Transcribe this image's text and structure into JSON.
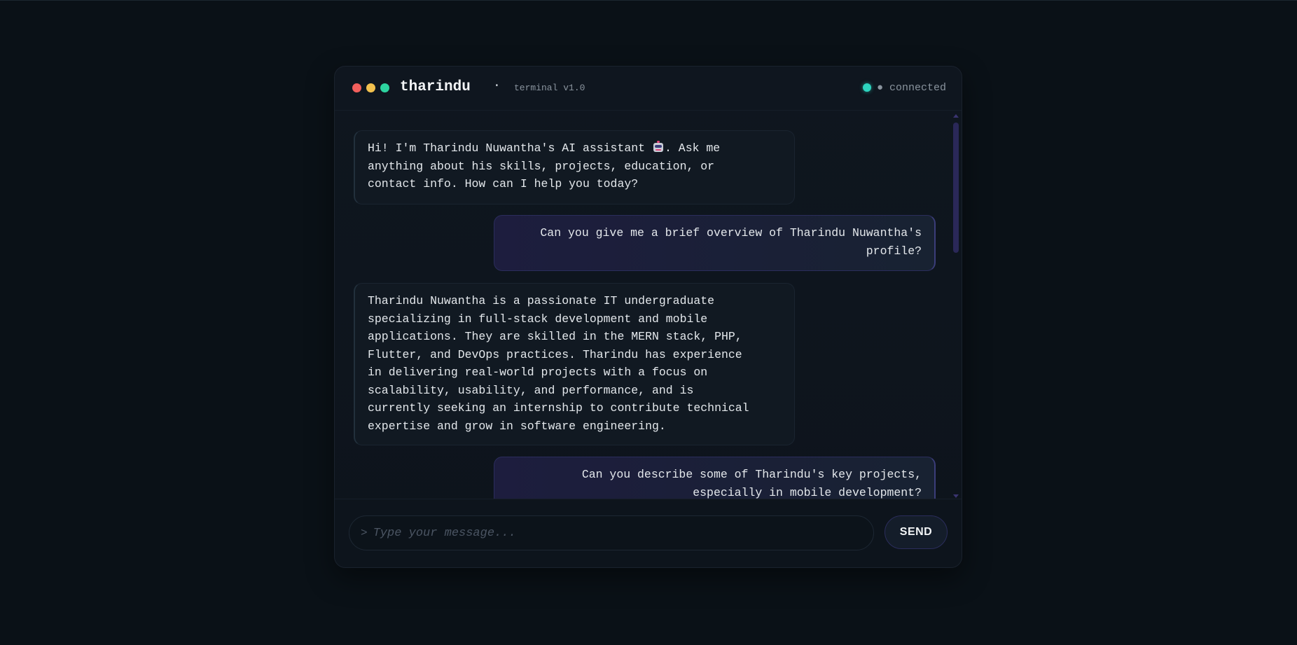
{
  "header": {
    "title": "tharindu",
    "separator": "·",
    "subtitle": "terminal v1.0",
    "status_text": "● connected"
  },
  "messages": [
    {
      "role": "assistant",
      "text_before_icon": "Hi! I'm Tharindu Nuwantha's AI assistant",
      "icon": "robot-icon",
      "text_after_icon": ". Ask me\nanything about his skills, projects, education, or\ncontact info. How can I help you today?"
    },
    {
      "role": "user",
      "text": "Can you give me a brief overview of Tharindu Nuwantha's\nprofile?"
    },
    {
      "role": "assistant",
      "text": "Tharindu Nuwantha is a passionate IT undergraduate\nspecializing in full-stack development and mobile\napplications. They are skilled in the MERN stack, PHP,\nFlutter, and DevOps practices. Tharindu has experience\nin delivering real-world projects with a focus on\nscalability, usability, and performance, and is\ncurrently seeking an internship to contribute technical\nexpertise and grow in software engineering."
    },
    {
      "role": "user",
      "text": "Can you describe some of Tharindu's key projects,\nespecially in mobile development?"
    }
  ],
  "composer": {
    "prompt_symbol": ">",
    "placeholder": "Type your message...",
    "send_label": "SEND"
  },
  "colors": {
    "background": "#0a1117",
    "window_bg": "#0f161f",
    "accent": "#2dd4bf",
    "traffic_red": "#f25f5c",
    "traffic_yellow": "#f2c14e",
    "traffic_green": "#2dd4a0",
    "user_bubble": "#1d1d3e"
  }
}
